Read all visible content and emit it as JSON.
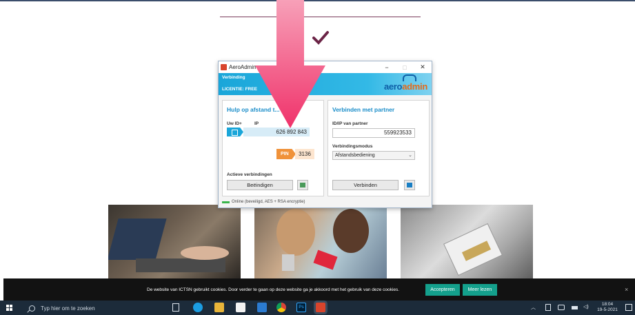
{
  "window": {
    "title": "AeroAdmin",
    "connection_label": "Verbinding",
    "license": "LICENTIE: FREE",
    "logo_part1": "aero",
    "logo_part2": "admin",
    "controls": [
      "−",
      "□",
      "✕"
    ]
  },
  "left_panel": {
    "title": "Hulp op afstand t...",
    "id_label": "Uw ID+",
    "ip_label": "IP",
    "id_value": "626 892 843",
    "pin_label": "PIN",
    "pin_value": "3136",
    "active_label": "Actieve verbindingen",
    "end_button": "Beëindigen"
  },
  "right_panel": {
    "title": "Verbinden met partner",
    "partner_label": "ID/IP van partner",
    "partner_value": "559923533",
    "mode_label": "Verbindingsmodus",
    "mode_value": "Afstandsbediening",
    "connect_button": "Verbinden"
  },
  "status": "Online (beveiligd, AES + RSA encryptie)",
  "cookie": {
    "text": "De website van ICTSN gebruikt cookies. Door verder te gaan op deze website ga je akkoord met het gebruik van deze cookies.",
    "accept": "Accepteren",
    "more": "Meer lezen",
    "close": "×"
  },
  "taskbar": {
    "search_placeholder": "Typ hier om te zoeken",
    "time": "18:04",
    "date": "19-5-2021",
    "ps_label": "Ps"
  },
  "colors": {
    "accent_blue": "#1aa6d9",
    "arrow_pink": "#f0507a",
    "cookie_button": "#14a08c",
    "check_purple": "#6b2446"
  },
  "icons": [
    "check-icon",
    "windows-start-icon",
    "search-icon",
    "task-view-icon",
    "edge-icon",
    "file-explorer-icon",
    "store-icon",
    "mail-icon",
    "chrome-icon",
    "photoshop-icon",
    "aeroadmin-icon"
  ]
}
